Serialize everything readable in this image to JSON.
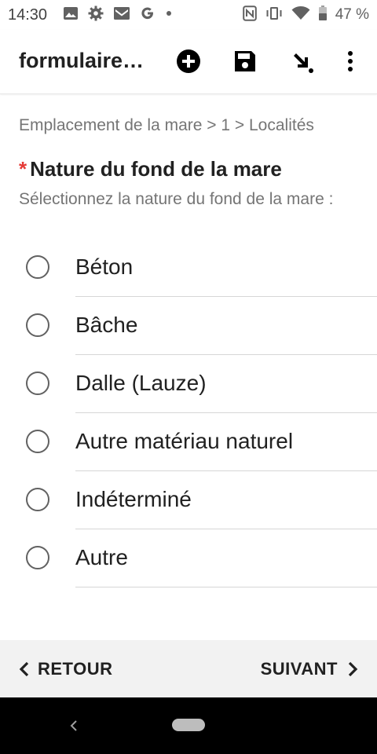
{
  "status_bar": {
    "time": "14:30",
    "battery_text": "47 %",
    "icons_left": [
      "image-icon",
      "gear-icon",
      "gmail-icon",
      "google-icon",
      "dot-icon"
    ],
    "icons_right": [
      "nfc-icon",
      "vibrate-icon",
      "wifi-icon",
      "battery-icon"
    ]
  },
  "app_bar": {
    "title": "formulaire…",
    "actions": [
      "add-circle-icon",
      "save-icon",
      "arrow-down-right-icon",
      "more-vert-icon"
    ]
  },
  "form": {
    "breadcrumb": "Emplacement de la mare > 1 > Localités",
    "required_mark": "*",
    "question": "Nature du fond de la mare",
    "hint": "Sélectionnez la nature du fond de la mare :",
    "options": [
      {
        "label": "Béton"
      },
      {
        "label": "Bâche"
      },
      {
        "label": "Dalle (Lauze)"
      },
      {
        "label": "Autre matériau naturel"
      },
      {
        "label": "Indéterminé"
      },
      {
        "label": "Autre"
      }
    ]
  },
  "footer": {
    "back_label": "RETOUR",
    "next_label": "SUIVANT"
  },
  "colors": {
    "required": "#e53935",
    "text_primary": "#212121",
    "text_secondary": "#757575",
    "footer_bg": "#f2f2f2"
  }
}
